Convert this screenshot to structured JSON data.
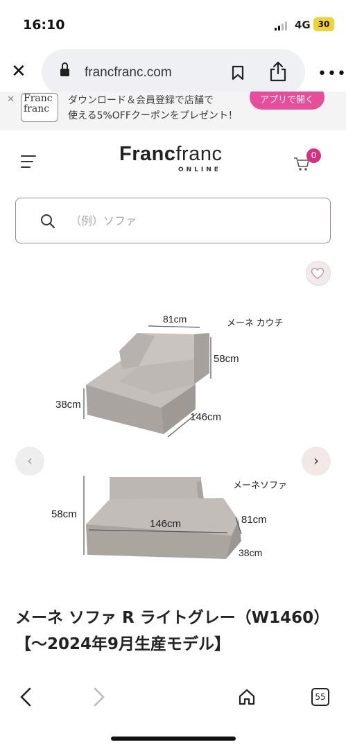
{
  "status_bar": {
    "time": "16:10",
    "network": "4G",
    "battery": "30"
  },
  "browser": {
    "url": "francfranc.com",
    "icons": [
      "close-icon",
      "lock-icon",
      "bookmark-icon",
      "share-icon",
      "more-icon"
    ]
  },
  "promo": {
    "logo_line1": "Franc",
    "logo_line2": "franc",
    "text_line1": "ダウンロード＆会員登録で店舗で",
    "text_line2": "使える5%OFFクーポンをプレゼント！",
    "button_label": "アプリで開く"
  },
  "header": {
    "logo_bold": "Franc",
    "logo_light": "franc",
    "logo_sub": "ONLINE",
    "cart_count": "0"
  },
  "search": {
    "placeholder": "（例）ソファ"
  },
  "product": {
    "image_labels": {
      "chaise_name": "メーネ カウチ",
      "chaise_width": "81cm",
      "chaise_back_height": "58cm",
      "chaise_seat_height": "38cm",
      "chaise_length": "146cm",
      "sofa_name": "メーネソファ",
      "sofa_height": "58cm",
      "sofa_width": "146cm",
      "sofa_depth": "81cm",
      "sofa_seat_height": "38cm"
    },
    "title": "メーネ ソファ R ライトグレー（W1460）【～2024年9月生産モデル】"
  },
  "toolbar": {
    "tab_count": "55"
  },
  "colors": {
    "accent_pink": "#d6317f",
    "promo_button": "#e84d9a",
    "sofa_gray": "#b9b4af"
  }
}
